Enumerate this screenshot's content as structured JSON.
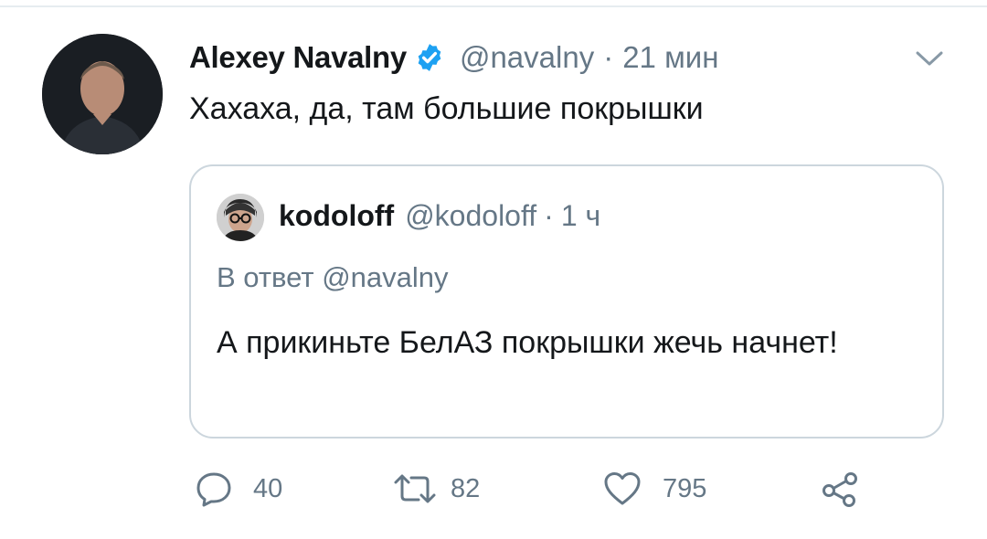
{
  "tweet": {
    "author_name": "Alexey Navalny",
    "handle": "@navalny",
    "separator": "·",
    "time": "21 мин",
    "text": "Хахаха, да, там большие покрышки",
    "avatar_icon": "author-avatar",
    "verified_icon": "verified-badge-icon",
    "menu_icon": "chevron-down-icon"
  },
  "quote": {
    "author_name": "kodoloff",
    "handle": "@kodoloff",
    "separator": "·",
    "time": "1 ч",
    "reply_prefix": "В ответ",
    "reply_to": "@navalny",
    "text": "А прикиньте БелАЗ покрышки жечь начнет!"
  },
  "actions": {
    "reply_count": "40",
    "retweet_count": "82",
    "like_count": "795",
    "icons": [
      "reply-icon",
      "retweet-icon",
      "like-icon",
      "share-icon"
    ]
  },
  "colors": {
    "text": "#14171a",
    "secondary": "#657786",
    "border": "#ccd6dd",
    "verified": "#1da1f2"
  }
}
